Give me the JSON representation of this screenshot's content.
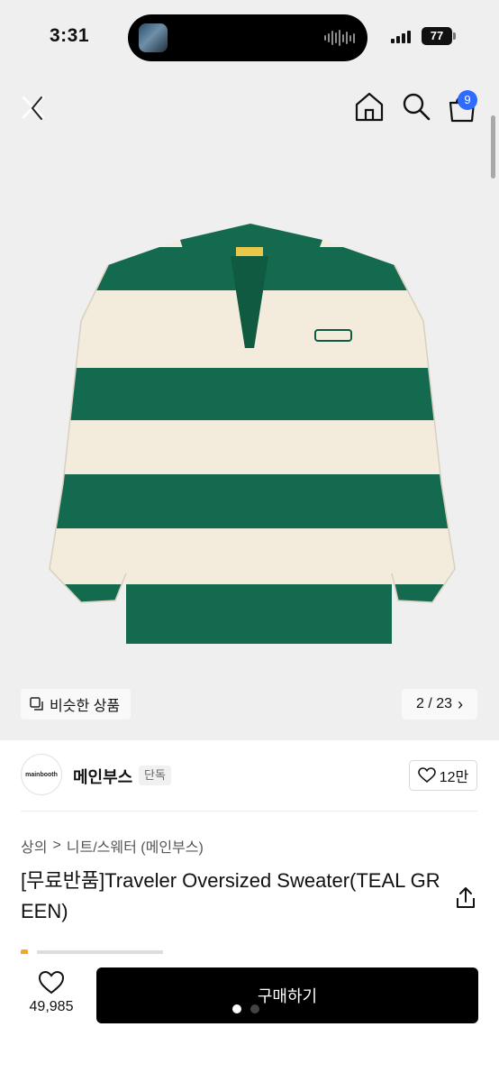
{
  "status_bar": {
    "time": "3:31",
    "battery": "77"
  },
  "header": {
    "cart_count": "9"
  },
  "gallery": {
    "similar_label": "비슷한 상품",
    "counter": "2 / 23",
    "chevron": "›"
  },
  "brand": {
    "logo_text": "mainbooth",
    "name": "메인부스",
    "tag": "단독",
    "likes": "12만"
  },
  "product": {
    "breadcrumb": [
      "상의",
      "니트/스웨터 (메인부스)"
    ],
    "breadcrumb_sep": ">",
    "title": "[무료반품]Traveler Oversized Sweater(TEAL GREEN)"
  },
  "bottom_bar": {
    "wish_count": "49,985",
    "buy_label": "구매하기"
  },
  "colors": {
    "accent": "#2f6bff",
    "teal": "#146a4e",
    "cream": "#f3ecdc"
  }
}
